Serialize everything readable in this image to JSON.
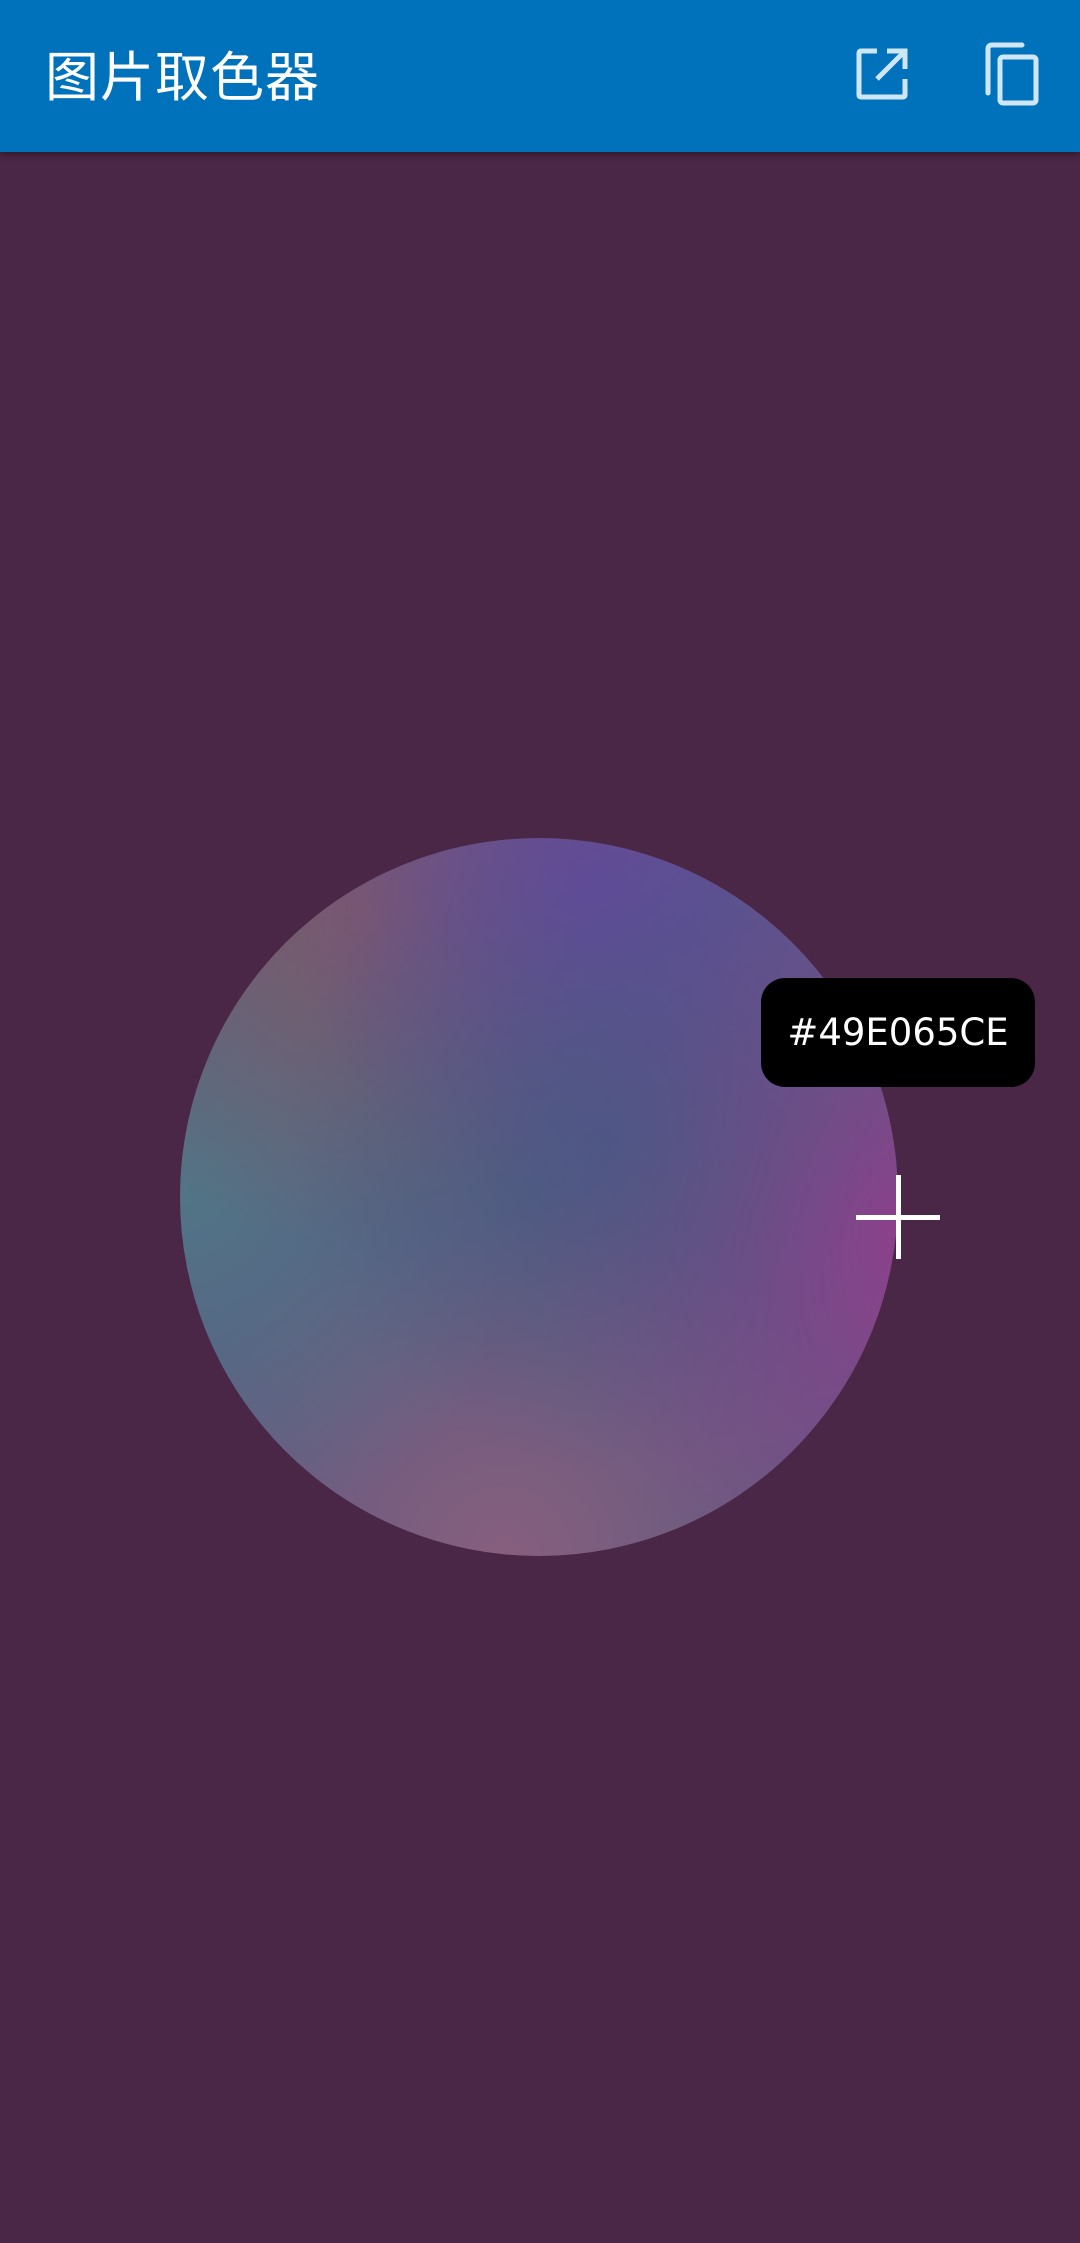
{
  "app_bar": {
    "title": "图片取色器",
    "background_color": "#0072bc",
    "actions": [
      {
        "name": "open-external",
        "icon": "open-in-new-icon"
      },
      {
        "name": "copy",
        "icon": "copy-icon"
      }
    ]
  },
  "canvas": {
    "background_color": "#4a2746"
  },
  "picker": {
    "color_label": "#49E065CE"
  }
}
